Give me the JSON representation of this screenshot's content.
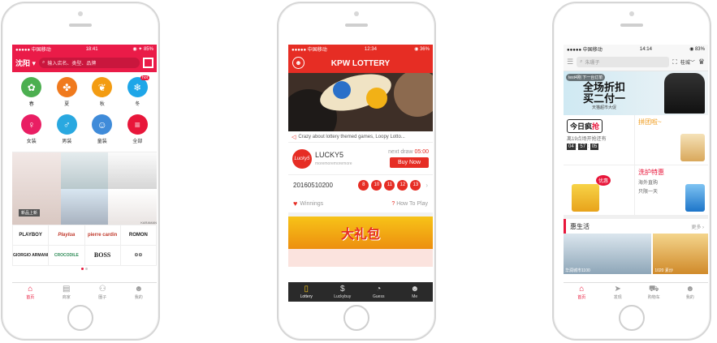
{
  "phones": [
    {
      "status": {
        "carrier": "●●●●● 中国移动",
        "time": "18:41",
        "battery": "◉ ✦ 85%"
      },
      "city": "沈阳",
      "search_placeholder": "输入店名、类型、品牌",
      "categories": [
        {
          "label": "春",
          "color": "#4caf50",
          "icon": "sprout-icon"
        },
        {
          "label": "夏",
          "color": "#f07a1e",
          "icon": "fan-icon"
        },
        {
          "label": "秋",
          "color": "#f39c12",
          "icon": "leaf-icon"
        },
        {
          "label": "冬",
          "color": "#1ea6e8",
          "icon": "snowflake-icon",
          "badge": "hot"
        },
        {
          "label": "女装",
          "color": "#e91e63",
          "icon": "dress-icon"
        },
        {
          "label": "男装",
          "color": "#29a8e0",
          "icon": "shirt-icon"
        },
        {
          "label": "童装",
          "color": "#3f8bd9",
          "icon": "baby-icon"
        },
        {
          "label": "全部",
          "color": "#e8163a",
          "icon": "menu-icon"
        }
      ],
      "banner_label": "新品上新",
      "banner_brand": "KARAMAN",
      "brands": [
        "PLAYBOY",
        "Playlua",
        "pierre cardin",
        "ROMON",
        "GIORGIO ARMANI",
        "CROCODILE",
        "BOSS",
        "⊙⊙"
      ],
      "tabs": [
        {
          "label": "首页",
          "icon": "home-icon",
          "active": true
        },
        {
          "label": "商家",
          "icon": "store-icon",
          "active": false
        },
        {
          "label": "圈子",
          "icon": "people-icon",
          "active": false
        },
        {
          "label": "我的",
          "icon": "user-icon",
          "active": false
        }
      ]
    },
    {
      "status": {
        "carrier": "●●●●● 中国移动",
        "time": "12:34",
        "battery": "◉ 36%"
      },
      "title": "KPW LOTTERY",
      "caption": "Crazy about lottery themed games, Loopy Lotto...",
      "lottery": {
        "logo": "Lucky5",
        "name": "LUCKY5",
        "sub": "moremoremoremore",
        "next_label": "next draw",
        "next_time": "05:00",
        "buy": "Buy Now"
      },
      "draw_id": "20160510200",
      "balls": [
        "8",
        "10",
        "11",
        "12",
        "13"
      ],
      "winnings": "Winnings",
      "howto": "How To Play",
      "promo_text": "大礼包",
      "tabs": [
        {
          "label": "Lottery",
          "icon": "phone-icon",
          "active": true
        },
        {
          "label": "Luckybuy",
          "icon": "dollar-icon",
          "active": false
        },
        {
          "label": "Guess",
          "icon": "chat-icon",
          "active": false
        },
        {
          "label": "Me",
          "icon": "user-icon",
          "active": false
        }
      ]
    },
    {
      "status": {
        "carrier": "●●●●● 中国移动",
        "time": "14:14",
        "battery": "◉ 83%"
      },
      "search_placeholder": "朱珊子",
      "city": "桂城",
      "ad_tag": "test4刚 下一台订单",
      "ad_big_1": "全场折扣",
      "ad_big_2": "买二付一",
      "ad_small": "天猫超市大促",
      "today_1": "今日",
      "today_2": "疯",
      "today_3": "抢",
      "today_sub": "离19点场开抢还有",
      "countdown": [
        "04",
        "57",
        "05"
      ],
      "group_title": "拼团啦~",
      "care_title": "洗护特惠",
      "care_sub1": "海外直购",
      "care_sub2": "只限一天",
      "sale_badge": "优惠",
      "life_title": "惠生活",
      "life_more": "更多 ›",
      "img_a": "华润城市1100",
      "img_b": "1020 素炒",
      "tabs": [
        {
          "label": "首页",
          "icon": "home-icon",
          "active": true
        },
        {
          "label": "发现",
          "icon": "send-icon",
          "active": false
        },
        {
          "label": "购物车",
          "icon": "cart-icon",
          "active": false
        },
        {
          "label": "我的",
          "icon": "user-icon",
          "active": false
        }
      ]
    }
  ]
}
